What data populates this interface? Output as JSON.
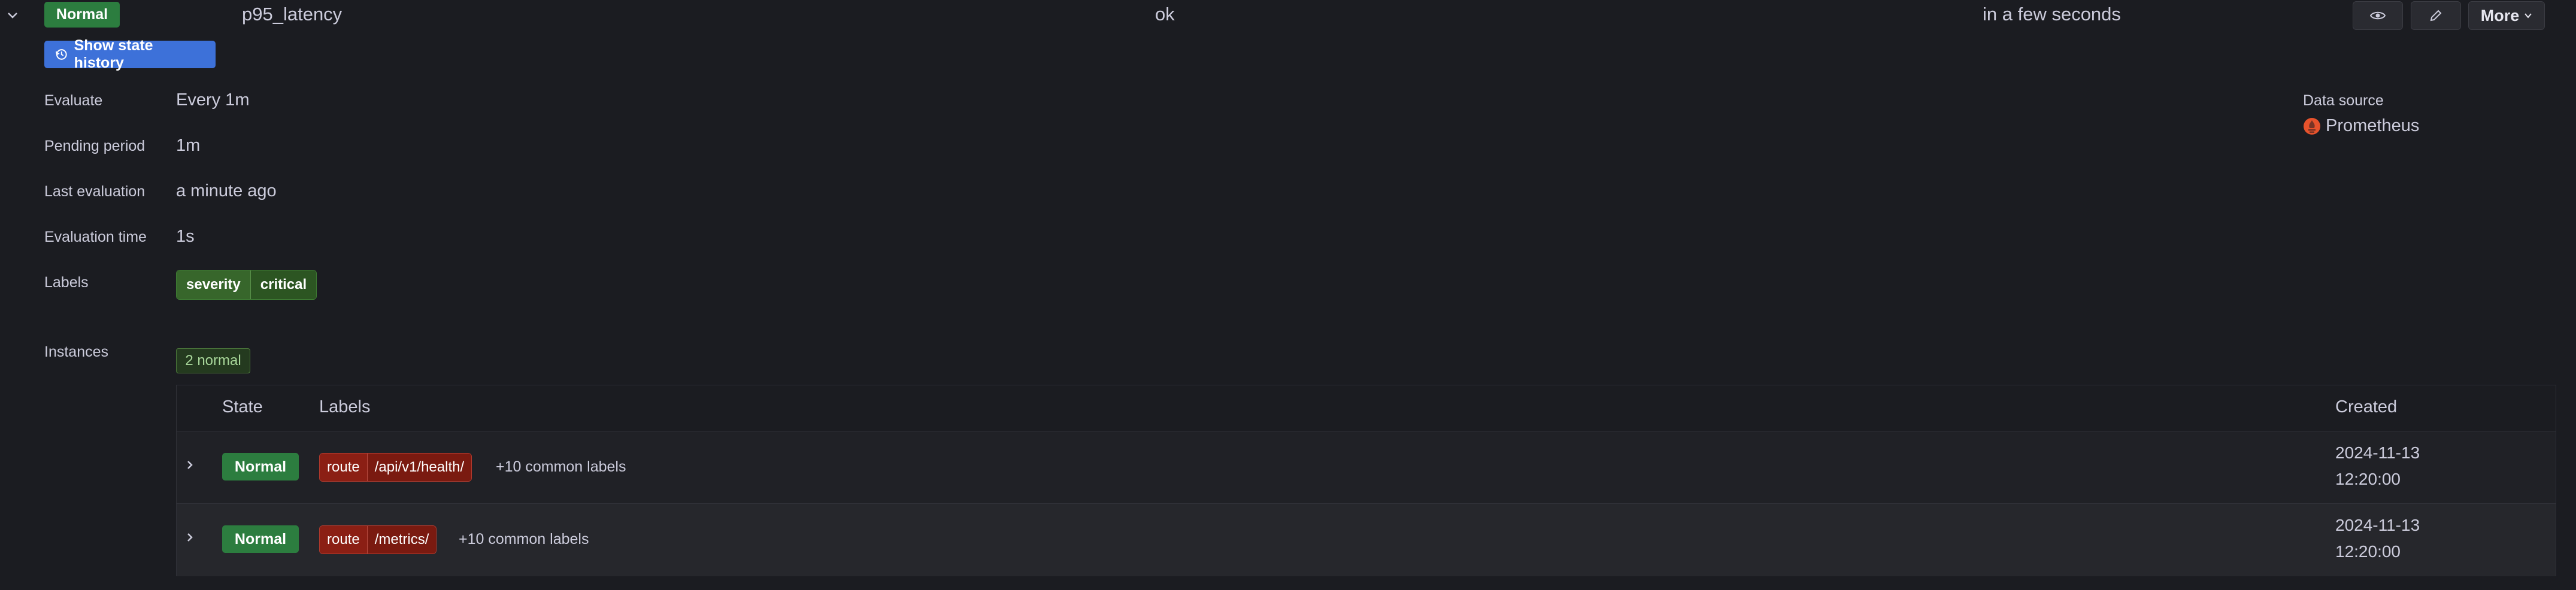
{
  "rule": {
    "state": "Normal",
    "name": "p95_latency",
    "health": "ok",
    "next_eval": "in a few seconds",
    "more_label": "More"
  },
  "history_button": "Show state history",
  "details": {
    "evaluate_key": "Evaluate",
    "evaluate_val": "Every 1m",
    "pending_key": "Pending period",
    "pending_val": "1m",
    "last_eval_key": "Last evaluation",
    "last_eval_val": "a minute ago",
    "eval_time_key": "Evaluation time",
    "eval_time_val": "1s",
    "labels_key": "Labels",
    "label_key": "severity",
    "label_val": "critical",
    "instances_key": "Instances",
    "instances_count": "2 normal"
  },
  "data_source": {
    "title": "Data source",
    "name": "Prometheus"
  },
  "table": {
    "headers": {
      "state": "State",
      "labels": "Labels",
      "created": "Created"
    },
    "rows": [
      {
        "state": "Normal",
        "label_key": "route",
        "label_val": "/api/v1/health/",
        "common": "+10 common labels",
        "created_date": "2024-11-13",
        "created_time": "12:20:00"
      },
      {
        "state": "Normal",
        "label_key": "route",
        "label_val": "/metrics/",
        "common": "+10 common labels",
        "created_date": "2024-11-13",
        "created_time": "12:20:00"
      }
    ]
  },
  "icons": {
    "collapse": "chevron-down-icon",
    "history": "history-icon",
    "view": "eye-icon",
    "edit": "pencil-icon",
    "more": "chevron-down-icon",
    "datasource": "prometheus-icon",
    "expand": "chevron-right-icon"
  },
  "colors": {
    "normal": "#2c7d3f",
    "history_button": "#3d71d9",
    "route_label": "#8b1f14",
    "severity_label": "#37662b",
    "prometheus": "#e6522c"
  }
}
